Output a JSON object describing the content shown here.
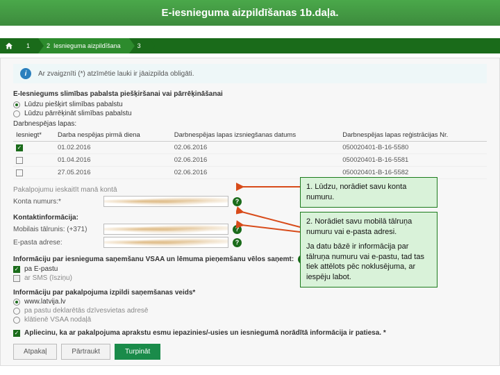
{
  "slide_title": "E-iesnieguma aizpildīšanas 1b.daļa.",
  "breadcrumb": {
    "step1": "1",
    "step2_label": "Iesnieguma aizpildīšana",
    "step3": "3"
  },
  "info": "Ar zvaigznīti (*) atzīmētie lauki ir jāaizpilda obligāti.",
  "form_title": "E-Iesniegums slimības pabalsta piešķiršanai vai pārrēķināšanai",
  "choice": {
    "opt1": "Lūdzu piešķirt slimības pabalstu",
    "opt2": "Lūdzu pārrēķināt slimības pabalstu"
  },
  "dnl_label": "Darbnespējas lapas:",
  "table": {
    "h1": "Iesniegt*",
    "h2": "Darba nespējas pirmā diena",
    "h3": "Darbnespējas lapas izsniegšanas datums",
    "h4": "Darbnespējas lapas reģistrācijas Nr.",
    "rows": [
      {
        "d1": "01.02.2016",
        "d2": "02.06.2016",
        "reg": "050020401-B-16-5580"
      },
      {
        "d1": "01.04.2016",
        "d2": "02.06.2016",
        "reg": "050020401-B-16-5581"
      },
      {
        "d1": "27.05.2016",
        "d2": "02.06.2016",
        "reg": "050020401-B-16-5582"
      }
    ]
  },
  "account_section": "Pakalpojumu ieskaitīt manā kontā",
  "account_label": "Konta numurs:*",
  "contact_section": "Kontaktinformācija:",
  "phone_label": "Mobilais tālrunis: (+371)",
  "email_label": "E-pasta adrese:",
  "notify_section": "Informāciju par iesnieguma saņemšanu VSAA un lēmuma pieņemšanu vēlos saņemt:",
  "notify1": "pa E-pastu",
  "notify2": "ar SMS (īsziņu)",
  "response_section": "Informāciju par pakalpojuma izpildi saņemšanas veids*",
  "resp1": "www.latvija.lv",
  "resp2": "pa pastu deklarētās dzīvesvietas adresē",
  "resp3": "klātienē VSAA nodaļā",
  "confirm": "Apliecinu, ka ar pakalpojuma aprakstu esmu iepazinies/-usies un iesniegumā norādītā informācija ir patiesa. *",
  "buttons": {
    "back": "Atpakaļ",
    "cancel": "Pārtraukt",
    "next": "Turpināt"
  },
  "callout1": "1. Lūdzu, norādiet savu konta numuru.",
  "callout2a": "2. Norādiet savu mobilā tālruņa numuru vai e-pasta adresi.",
  "callout2b": "Ja datu bāzē ir informācija par tālruņa numuru vai e-pastu, tad tas tiek attēlots pēc noklusējuma, ar iespēju labot."
}
